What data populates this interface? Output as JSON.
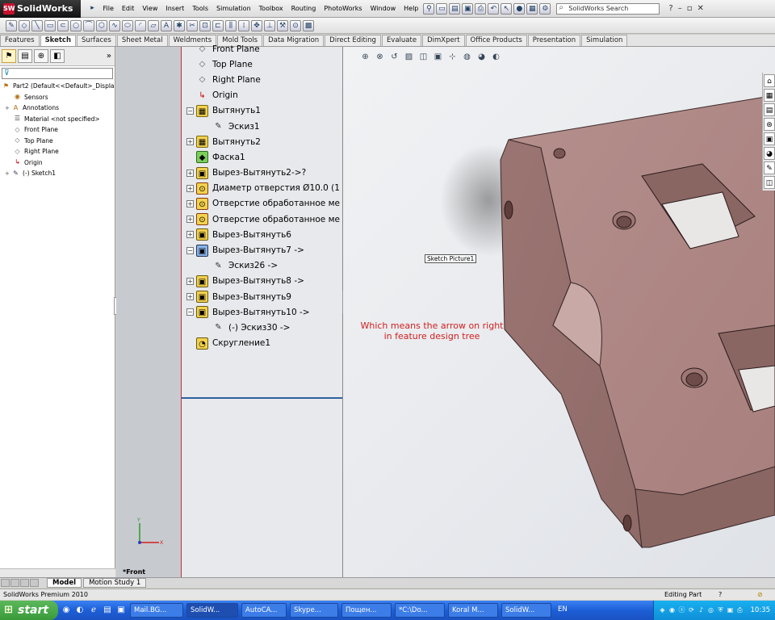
{
  "app": {
    "name": "SolidWorks",
    "menus": [
      "File",
      "Edit",
      "View",
      "Insert",
      "Tools",
      "Simulation",
      "Toolbox",
      "Routing",
      "PhotoWorks",
      "Window",
      "Help"
    ],
    "search_placeholder": "SolidWorks Search",
    "help_label": "?"
  },
  "command_tabs": [
    "Features",
    "Sketch",
    "Surfaces",
    "Sheet Metal",
    "Weldments",
    "Mold Tools",
    "Data Migration",
    "Direct Editing",
    "Evaluate",
    "DimXpert",
    "Office Products",
    "Presentation",
    "Simulation"
  ],
  "active_command_tab": "Sketch",
  "left_tree": {
    "filter": "",
    "root": "Part2  (Default<<Default>_Displa",
    "items": [
      "Sensors",
      "Annotations",
      "Material <not specified>",
      "Front Plane",
      "Top Plane",
      "Right Plane",
      "Origin",
      "(-) Sketch1"
    ]
  },
  "feature_tree": {
    "items": [
      {
        "label": "Front Plane",
        "icon": "plane-icon",
        "expand": ""
      },
      {
        "label": "Top Plane",
        "icon": "plane-icon",
        "expand": ""
      },
      {
        "label": "Right Plane",
        "icon": "plane-icon",
        "expand": ""
      },
      {
        "label": "Origin",
        "icon": "origin-icon",
        "expand": ""
      },
      {
        "label": "Вытянуть1",
        "icon": "extrude-icon",
        "expand": "−"
      },
      {
        "label": "Эскиз1",
        "icon": "sketch-icon",
        "expand": "",
        "indent": true
      },
      {
        "label": "Вытянуть2",
        "icon": "extrude-icon",
        "expand": "+"
      },
      {
        "label": "Фаска1",
        "icon": "chamfer-icon",
        "expand": ""
      },
      {
        "label": "Вырез-Вытянуть2->?",
        "icon": "cut-extrude-icon",
        "expand": "+"
      },
      {
        "label": "Диаметр отверстия Ø10.0 (1",
        "icon": "hole-icon",
        "expand": "+"
      },
      {
        "label": "Отверстие обработанное ме",
        "icon": "hole-icon",
        "expand": "+"
      },
      {
        "label": "Отверстие обработанное ме",
        "icon": "hole-icon",
        "expand": "+"
      },
      {
        "label": "Вырез-Вытянуть6",
        "icon": "cut-extrude-icon",
        "expand": "+"
      },
      {
        "label": "Вырез-Вытянуть7 ->",
        "icon": "cut-extrude-selected-icon",
        "expand": "−"
      },
      {
        "label": "Эскиз26 ->",
        "icon": "sketch-icon",
        "expand": "",
        "indent": true
      },
      {
        "label": "Вырез-Вытянуть8 ->",
        "icon": "cut-extrude-icon",
        "expand": "+"
      },
      {
        "label": "Вырез-Вытянуть9",
        "icon": "cut-extrude-icon",
        "expand": "+"
      },
      {
        "label": "Вырез-Вытянуть10 ->",
        "icon": "cut-extrude-icon",
        "expand": "−"
      },
      {
        "label": "(-) Эскиз30 ->",
        "icon": "sketch-icon",
        "expand": "",
        "indent": true
      },
      {
        "label": "Скругление1",
        "icon": "fillet-icon",
        "expand": ""
      }
    ]
  },
  "viewport": {
    "view_label": "*Front",
    "tooltip": "Sketch Picture1",
    "annotation": "Which means the arrow on right in feature design tree",
    "annotation_color": "#d02020",
    "part_color": "#b89a96"
  },
  "bottom_tabs": [
    "Model",
    "Motion Study 1"
  ],
  "status": {
    "left": "SolidWorks Premium 2010",
    "right": "Editing Part"
  },
  "taskbar": {
    "start": "start",
    "buttons": [
      "Mail.BG...",
      "SolidW...",
      "AutoCA...",
      "Skype...",
      "Пощен...",
      "*C:\\Do...",
      "Koral M...",
      "SolidW..."
    ],
    "language": "EN",
    "clock": "10:35"
  }
}
